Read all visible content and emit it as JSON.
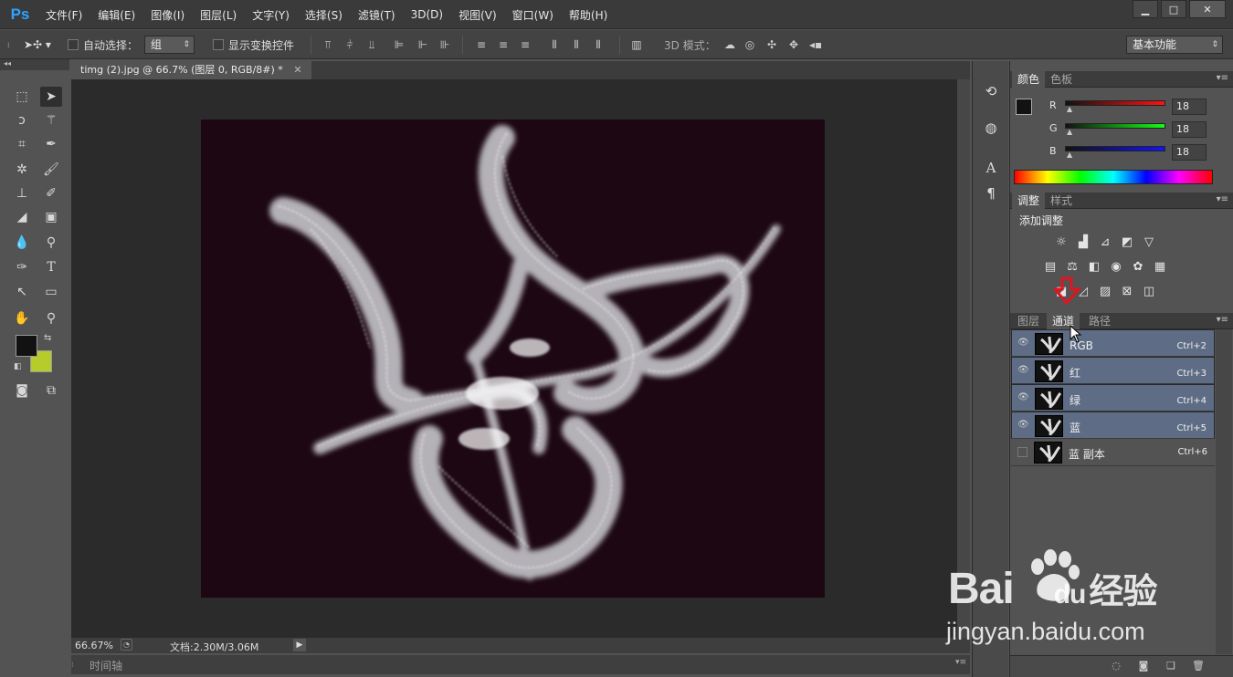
{
  "app": {
    "logo": "Ps"
  },
  "menubar": {
    "items": [
      "文件(F)",
      "编辑(E)",
      "图像(I)",
      "图层(L)",
      "文字(Y)",
      "选择(S)",
      "滤镜(T)",
      "3D(D)",
      "视图(V)",
      "窗口(W)",
      "帮助(H)"
    ],
    "window_controls": [
      "minimize",
      "restore",
      "close"
    ]
  },
  "options_bar": {
    "auto_select_label": "自动选择：",
    "auto_select_value": "组",
    "show_transform_label": "显示变换控件",
    "mode_3d_label": "3D 模式：",
    "workspace": "基本功能"
  },
  "document": {
    "tab_title": "timg (2).jpg @ 66.7% (图层 0, RGB/8#) *",
    "zoom": "66.67%",
    "doc_size": "文档:2.30M/3.06M",
    "timeline_label": "时间轴"
  },
  "color_panel": {
    "tabs": [
      "颜色",
      "色板"
    ],
    "r_label": "R",
    "g_label": "G",
    "b_label": "B",
    "r": "18",
    "g": "18",
    "b": "18",
    "foreground": "#121212",
    "background": "#b5cc2a"
  },
  "adjustments_panel": {
    "tabs": [
      "调整",
      "样式"
    ],
    "title": "添加调整"
  },
  "channels_panel": {
    "tabs": [
      "图层",
      "通道",
      "路径"
    ],
    "active_tab": "通道",
    "channels": [
      {
        "name": "RGB",
        "shortcut": "Ctrl+2",
        "visible": true,
        "selected": true
      },
      {
        "name": "红",
        "shortcut": "Ctrl+3",
        "visible": true,
        "selected": true
      },
      {
        "name": "绿",
        "shortcut": "Ctrl+4",
        "visible": true,
        "selected": true
      },
      {
        "name": "蓝",
        "shortcut": "Ctrl+5",
        "visible": true,
        "selected": true
      },
      {
        "name": "蓝 副本",
        "shortcut": "Ctrl+6",
        "visible": false,
        "selected": false
      }
    ]
  },
  "watermark": {
    "brand_a": "Bai",
    "brand_b": "du",
    "brand_c": "经验",
    "url": "jingyan.baidu.com"
  },
  "colors": {
    "accent": "#2fa3ff",
    "selection": "#5e6d85",
    "arrow": "#e0141e"
  }
}
